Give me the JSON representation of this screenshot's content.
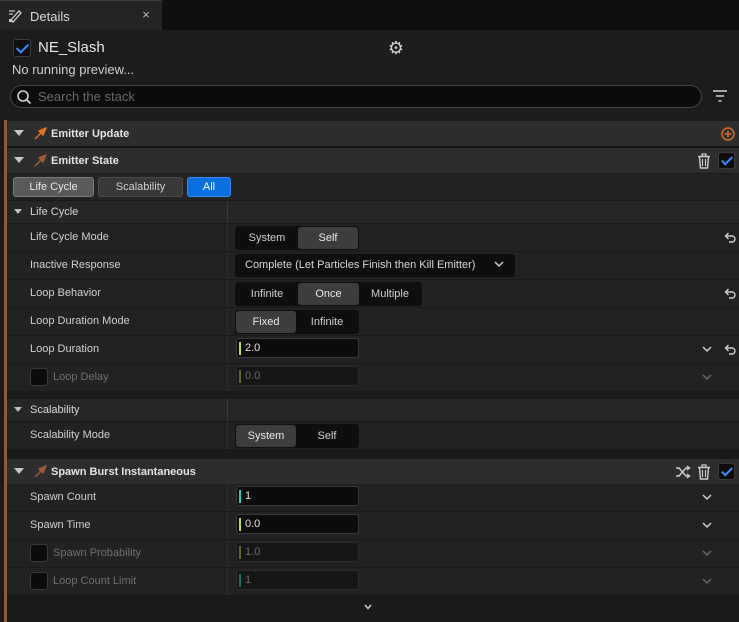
{
  "tab": {
    "label": "Details",
    "close": "×"
  },
  "emitter": {
    "name": "NE_Slash",
    "enabled": true
  },
  "preview_status": "No running preview...",
  "search": {
    "placeholder": "Search the stack",
    "value": ""
  },
  "colors": {
    "accent_orange": "#e07028",
    "selected_blue": "#0a70e0",
    "check_blue": "#3c8dff"
  },
  "emitter_update": {
    "title": "Emitter Update",
    "icon": "emitter-update-icon",
    "action_icon": "add-icon"
  },
  "emitter_state": {
    "title": "Emitter State",
    "icon": "module-icon",
    "enabled": true,
    "filters": [
      {
        "label": "Life Cycle",
        "selected": false
      },
      {
        "label": "Scalability",
        "selected": false
      },
      {
        "label": "All",
        "selected": true
      }
    ],
    "life_cycle": {
      "title": "Life Cycle",
      "mode": {
        "label": "Life Cycle Mode",
        "options": [
          "System",
          "Self"
        ],
        "selected": "Self"
      },
      "inactive_response": {
        "label": "Inactive Response",
        "value": "Complete (Let Particles Finish then Kill Emitter)"
      },
      "loop_behavior": {
        "label": "Loop Behavior",
        "options": [
          "Infinite",
          "Once",
          "Multiple"
        ],
        "selected": "Once"
      },
      "loop_duration_mode": {
        "label": "Loop Duration Mode",
        "options": [
          "Fixed",
          "Infinite"
        ],
        "selected": "Fixed"
      },
      "loop_duration": {
        "label": "Loop Duration",
        "value": "2.0"
      },
      "loop_delay": {
        "label": "Loop Delay",
        "value": "0.0",
        "enabled": false
      }
    },
    "scalability": {
      "title": "Scalability",
      "mode": {
        "label": "Scalability Mode",
        "options": [
          "System",
          "Self"
        ],
        "selected": "System"
      }
    }
  },
  "spawn_burst": {
    "title": "Spawn Burst Instantaneous",
    "icon": "module-icon",
    "enabled": true,
    "spawn_count": {
      "label": "Spawn Count",
      "value": "1"
    },
    "spawn_time": {
      "label": "Spawn Time",
      "value": "0.0"
    },
    "spawn_probability": {
      "label": "Spawn Probability",
      "value": "1.0",
      "enabled": false
    },
    "loop_count_limit": {
      "label": "Loop Count Limit",
      "value": "1",
      "enabled": false
    }
  }
}
